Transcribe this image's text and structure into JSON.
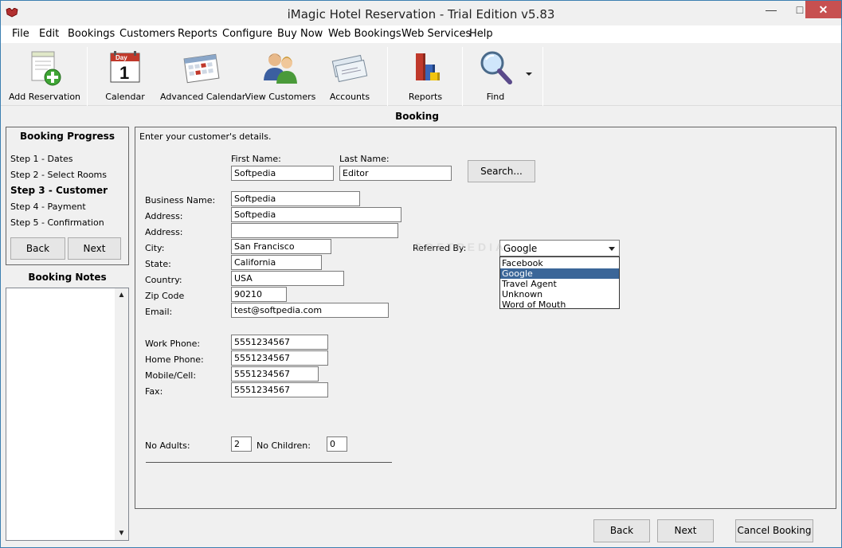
{
  "window": {
    "title": "iMagic Hotel Reservation - Trial Edition v5.83"
  },
  "menu": [
    "File",
    "Edit",
    "Bookings",
    "Customers",
    "Reports",
    "Configure",
    "Buy Now",
    "Web Bookings",
    "Web Services",
    "Help"
  ],
  "toolbar": {
    "add_reservation": "Add Reservation",
    "calendar": "Calendar",
    "advanced_calendar": "Advanced Calendar",
    "view_customers": "View Customers",
    "accounts": "Accounts",
    "reports": "Reports",
    "find": "Find",
    "calendar_day": "Day",
    "calendar_num": "1"
  },
  "section_title": "Booking",
  "booking_progress": {
    "title": "Booking Progress",
    "steps": [
      "Step 1 - Dates",
      "Step 2 - Select Rooms",
      "Step 3 - Customer",
      "Step 4 - Payment",
      "Step 5 - Confirmation"
    ],
    "back": "Back",
    "next": "Next"
  },
  "booking_notes": {
    "title": "Booking Notes"
  },
  "form": {
    "intro": "Enter your customer's details.",
    "first_name_label": "First Name:",
    "first_name": "Softpedia",
    "last_name_label": "Last Name:",
    "last_name": "Editor",
    "search": "Search...",
    "business_name_label": "Business Name:",
    "business_name": "Softpedia",
    "address_label": "Address:",
    "address1": "Softpedia",
    "address2": "",
    "city_label": "City:",
    "city": "San Francisco",
    "state_label": "State:",
    "state": "California",
    "country_label": "Country:",
    "country": "USA",
    "zip_label": "Zip Code",
    "zip": "90210",
    "email_label": "Email:",
    "email": "test@softpedia.com",
    "work_phone_label": "Work Phone:",
    "work_phone": "5551234567",
    "home_phone_label": "Home Phone:",
    "home_phone": "5551234567",
    "mobile_label": "Mobile/Cell:",
    "mobile": "5551234567",
    "fax_label": "Fax:",
    "fax": "5551234567",
    "adults_label": "No Adults:",
    "adults": "2",
    "children_label": "No Children:",
    "children": "0",
    "referred_label": "Referred By:",
    "referred_value": "Google",
    "referred_options": [
      "Facebook",
      "Google",
      "Travel Agent",
      "Unknown",
      "Word of Mouth"
    ]
  },
  "footer": {
    "back": "Back",
    "next": "Next",
    "cancel": "Cancel Booking"
  },
  "watermark": "SOFTPEDIA",
  "colors": {
    "selection": "#3b6698",
    "close_button": "#c75050"
  }
}
